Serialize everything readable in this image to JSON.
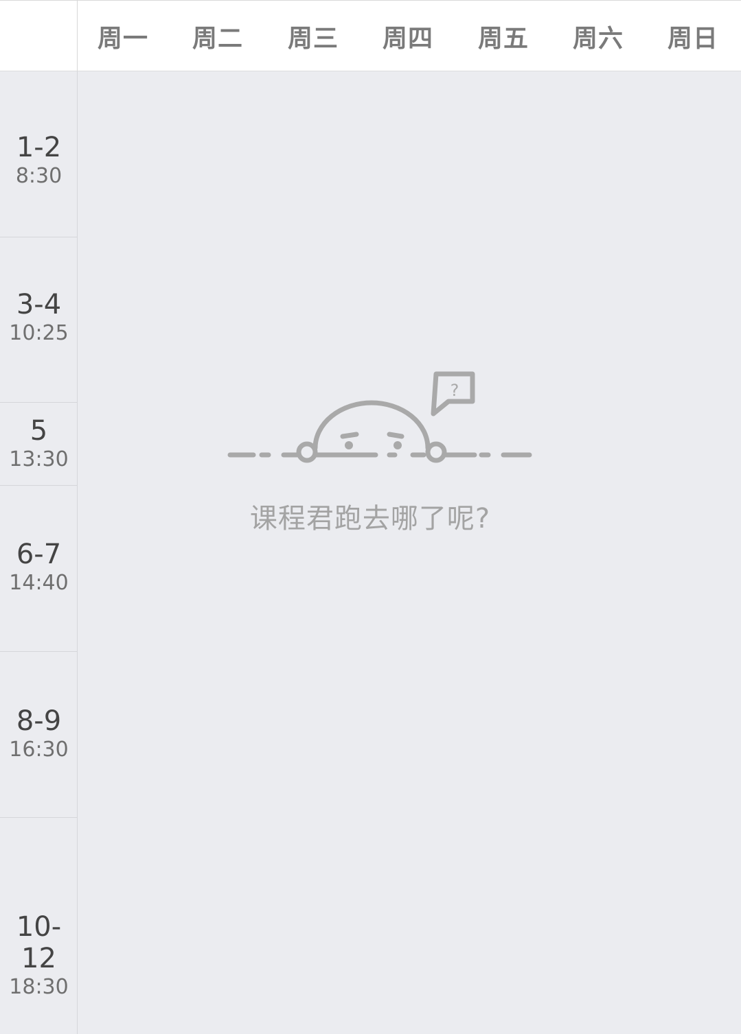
{
  "header": {
    "days": [
      "周一",
      "周二",
      "周三",
      "周四",
      "周五",
      "周六",
      "周日"
    ]
  },
  "sidebar": {
    "slots": [
      {
        "period": "1-2",
        "time": "8:30"
      },
      {
        "period": "3-4",
        "time": "10:25"
      },
      {
        "period": "5",
        "time": "13:30"
      },
      {
        "period": "6-7",
        "time": "14:40"
      },
      {
        "period": "8-9",
        "time": "16:30"
      },
      {
        "period": "10-12",
        "time": "18:30"
      }
    ]
  },
  "empty_state": {
    "icon": "peeking-face-icon",
    "bubble_mark": "?",
    "message": "课程君跑去哪了呢?"
  },
  "colors": {
    "background": "#ebecf0",
    "header": "#ffffff",
    "illustration": "#a9a9a9",
    "message": "#a3a3a3"
  }
}
